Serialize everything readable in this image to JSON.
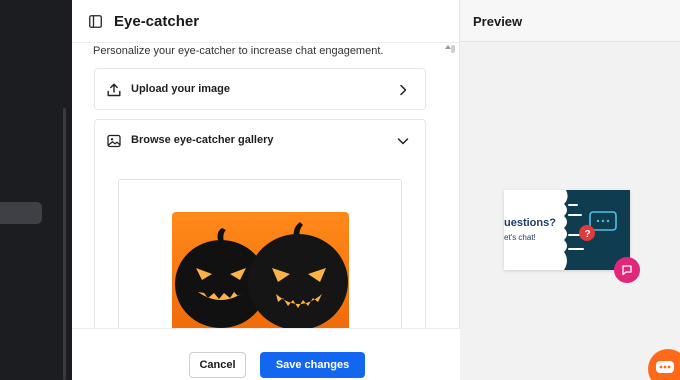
{
  "panel": {
    "title": "Eye-catcher",
    "description": "Personalize your eye-catcher to increase chat engagement.",
    "upload": {
      "label": "Upload your image",
      "icon": "upload-icon"
    },
    "gallery": {
      "label": "Browse eye-catcher gallery",
      "icon": "image-icon",
      "expanded": true
    }
  },
  "footer": {
    "cancel_label": "Cancel",
    "save_label": "Save changes"
  },
  "preview": {
    "title": "Preview",
    "catcher": {
      "headline": "uestions?",
      "subline": "et's chat!"
    }
  },
  "colors": {
    "accent": "#1366ef",
    "teal": "#0f3d4f",
    "pink": "#e0287b",
    "orange": "#ff6a1a"
  }
}
